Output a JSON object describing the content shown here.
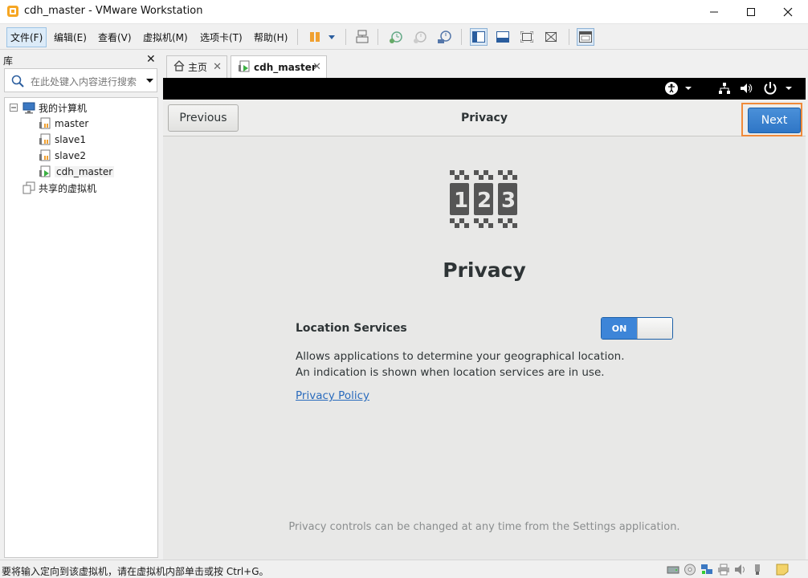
{
  "window": {
    "title": "cdh_master - VMware Workstation",
    "controls": [
      "minimize",
      "maximize",
      "close"
    ]
  },
  "menu": {
    "items": [
      "文件(F)",
      "编辑(E)",
      "查看(V)",
      "虚拟机(M)",
      "选项卡(T)",
      "帮助(H)"
    ]
  },
  "toolbar": {
    "icons": [
      "pause-icon",
      "dropdown-icon",
      "send-ctrl-alt-del-icon",
      "snapshot-take-icon",
      "snapshot-revert-icon",
      "snapshot-manager-icon",
      "show-library-icon",
      "thumbnail-bar-icon",
      "full-screen-icon",
      "unity-icon",
      "console-view-icon"
    ]
  },
  "library": {
    "title": "库",
    "close": "✕",
    "search_placeholder": "在此处键入内容进行搜索",
    "tree": {
      "root": "我的计算机",
      "vms": [
        "master",
        "slave1",
        "slave2",
        "cdh_master"
      ],
      "shared": "共享的虚拟机"
    }
  },
  "tabs": [
    {
      "label": "主页",
      "icon": "home-icon"
    },
    {
      "label": "cdh_master",
      "icon": "vm-running-icon"
    }
  ],
  "guest": {
    "topbar_icons": [
      "accessibility-icon",
      "network-icon",
      "volume-icon",
      "power-icon"
    ],
    "header": {
      "previous": "Previous",
      "title": "Privacy",
      "next": "Next"
    },
    "heading": "Privacy",
    "location_services": {
      "label": "Location Services",
      "toggle_state": "ON",
      "description": "Allows applications to determine your geographical location. An indication is shown when location services are in use."
    },
    "policy_link": "Privacy Policy",
    "footer": "Privacy controls can be changed at any time from the Settings application."
  },
  "status": {
    "message": "要将输入定向到该虚拟机，请在虚拟机内部单击或按 Ctrl+G。"
  },
  "colors": {
    "accent": "#3d85d8",
    "highlight_frame": "#f08a3a",
    "link": "#2a6bbd"
  }
}
